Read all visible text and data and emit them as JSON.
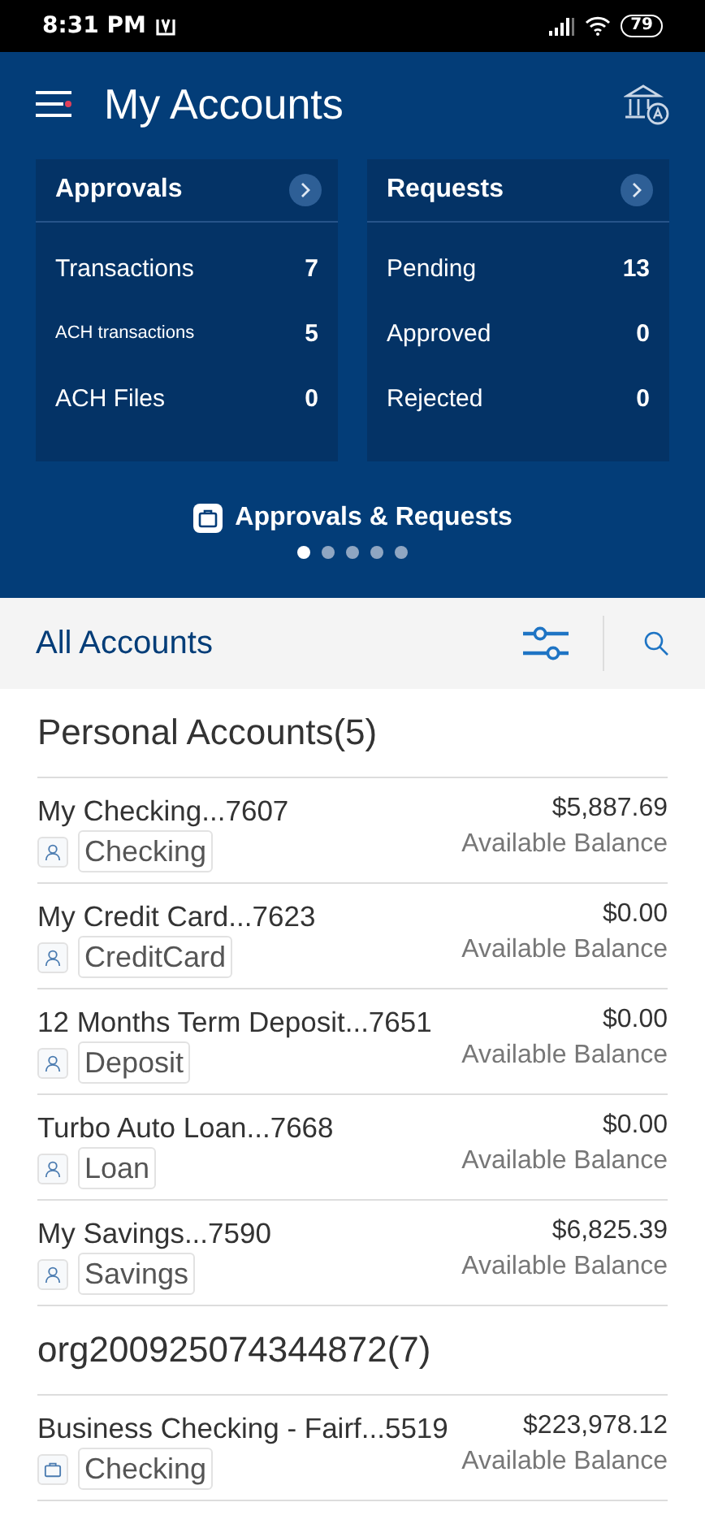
{
  "status_bar": {
    "time": "8:31 PM",
    "battery": "79"
  },
  "header": {
    "title": "My Accounts"
  },
  "cards": [
    {
      "title": "Approvals",
      "rows": [
        {
          "label": "Transactions",
          "count": "7"
        },
        {
          "label": "ACH transactions",
          "count": "5"
        },
        {
          "label": "ACH Files",
          "count": "0"
        }
      ]
    },
    {
      "title": "Requests",
      "rows": [
        {
          "label": "Pending",
          "count": "13"
        },
        {
          "label": "Approved",
          "count": "0"
        },
        {
          "label": "Rejected",
          "count": "0"
        }
      ]
    }
  ],
  "carousel": {
    "label": "Approvals & Requests",
    "dots": [
      {
        "selected": true
      },
      {
        "selected": false
      },
      {
        "selected": false
      },
      {
        "selected": false
      },
      {
        "selected": false
      }
    ]
  },
  "toolbar": {
    "title": "All Accounts"
  },
  "groups": [
    {
      "title": "Personal Accounts(5)",
      "accounts": [
        {
          "name": "My Checking...7607",
          "type": "Checking",
          "kind": "personal",
          "amount": "$5,887.69",
          "amount_label": "Available Balance"
        },
        {
          "name": "My Credit Card...7623",
          "type": "CreditCard",
          "kind": "personal",
          "amount": "$0.00",
          "amount_label": "Available Balance"
        },
        {
          "name": "12 Months Term Deposit...7651",
          "type": "Deposit",
          "kind": "personal",
          "amount": "$0.00",
          "amount_label": "Available Balance"
        },
        {
          "name": "Turbo Auto Loan...7668",
          "type": "Loan",
          "kind": "personal",
          "amount": "$0.00",
          "amount_label": "Available Balance"
        },
        {
          "name": "My Savings...7590",
          "type": "Savings",
          "kind": "personal",
          "amount": "$6,825.39",
          "amount_label": "Available Balance"
        }
      ]
    },
    {
      "title": "org200925074344872(7)",
      "accounts": [
        {
          "name": "Business Checking - Fairf...5519",
          "type": "Checking",
          "kind": "business",
          "amount": "$223,978.12",
          "amount_label": "Available Balance"
        }
      ]
    }
  ]
}
